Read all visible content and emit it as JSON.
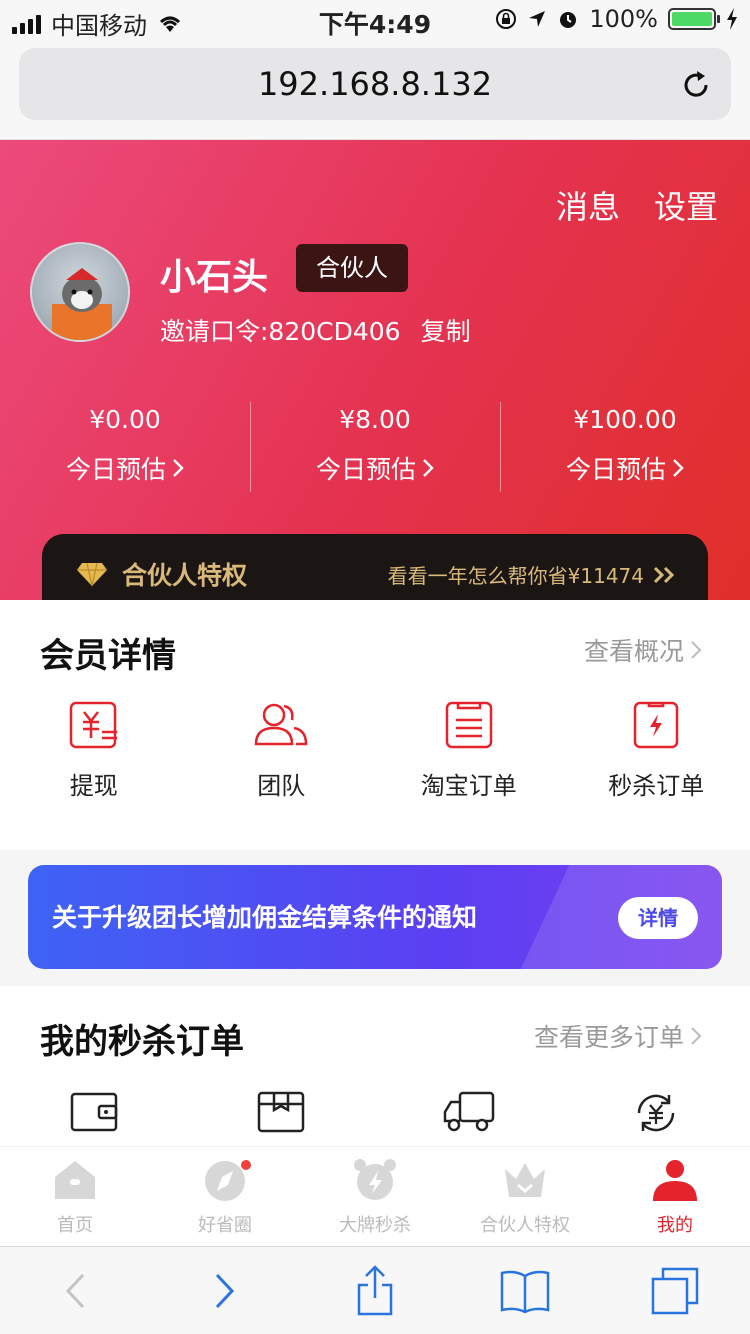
{
  "status_bar": {
    "carrier": "中国移动",
    "time": "下午4:49",
    "battery_pct": "100%",
    "battery_level": 1.0
  },
  "browser": {
    "url": "192.168.8.132"
  },
  "header": {
    "messages": "消息",
    "settings": "设置",
    "user_name": "小石头",
    "role_badge": "合伙人",
    "invite_code": "邀请口令:820CD406",
    "copy": "复制",
    "stats": [
      {
        "amount": "¥0.00",
        "label": "今日预估"
      },
      {
        "amount": "¥8.00",
        "label": "今日预估"
      },
      {
        "amount": "¥100.00",
        "label": "今日预估"
      }
    ],
    "partner_privilege": "合伙人特权",
    "partner_promo": "看看一年怎么帮你省¥11474"
  },
  "member": {
    "title": "会员详情",
    "more": "查看概况",
    "items": [
      {
        "label": "提现",
        "icon": "yuan-icon"
      },
      {
        "label": "团队",
        "icon": "team-icon"
      },
      {
        "label": "淘宝订单",
        "icon": "order-list-icon"
      },
      {
        "label": "秒杀订单",
        "icon": "flash-order-icon"
      }
    ]
  },
  "notice": {
    "text": "关于升级团长增加佣金结算条件的通知",
    "button": "详情"
  },
  "orders": {
    "title": "我的秒杀订单",
    "more": "查看更多订单"
  },
  "tabbar": [
    {
      "label": "首页",
      "icon": "home-icon"
    },
    {
      "label": "好省圈",
      "icon": "compass-icon"
    },
    {
      "label": "大牌秒杀",
      "icon": "alarm-icon"
    },
    {
      "label": "合伙人特权",
      "icon": "crown-icon"
    },
    {
      "label": "我的",
      "icon": "user-icon"
    }
  ],
  "colors": {
    "accent": "#e4232d",
    "header_start": "#ec4a7c",
    "header_end": "#e02f29",
    "notice_start": "#3e63f4",
    "notice_end": "#7a3ff0",
    "gold": "#d9b97a"
  }
}
